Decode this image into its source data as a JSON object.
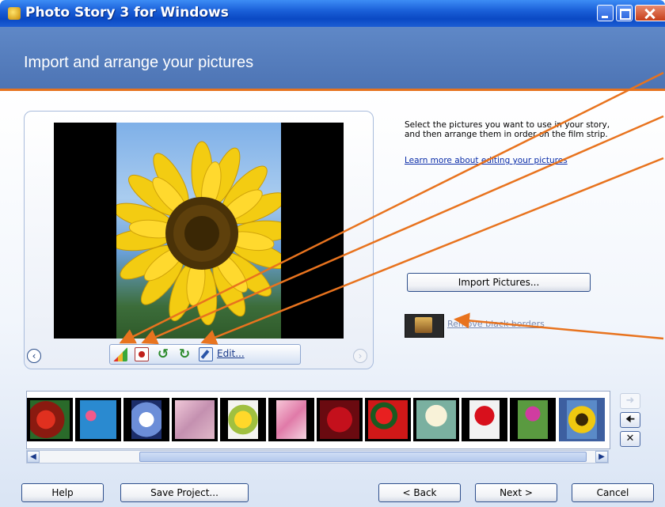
{
  "window": {
    "title": "Photo Story 3 for Windows"
  },
  "header": {
    "heading": "Import and arrange your pictures"
  },
  "instructions": {
    "line1": "Select the pictures you want to use in your story,",
    "line2": "and then arrange them in order on the film strip.",
    "learn_more": "Learn more about editing your pictures"
  },
  "import_button": "Import Pictures...",
  "remove_borders": "Remove black borders",
  "edit_toolbar": {
    "edit_label": "Edit...",
    "icons": [
      "auto-correct-levels-icon",
      "red-eye-icon",
      "rotate-left-icon",
      "rotate-right-icon",
      "edit-icon"
    ]
  },
  "filmstrip": {
    "thumbnails": [
      "red flowers",
      "pink flowers",
      "white flower",
      "blossoms",
      "yellow daffodil",
      "pink lily",
      "red rose",
      "red poinsettia",
      "white lilies",
      "red tulip",
      "thistle",
      "sunflower"
    ],
    "selected_index": 11
  },
  "footer": {
    "help": "Help",
    "save_project": "Save Project...",
    "back": "< Back",
    "next": "Next >",
    "cancel": "Cancel"
  },
  "colors": {
    "title_bar": "#1a5fd8",
    "header": "#5a82c2",
    "accent_line": "#e6731e",
    "annotation_arrow": "#e8731e"
  }
}
